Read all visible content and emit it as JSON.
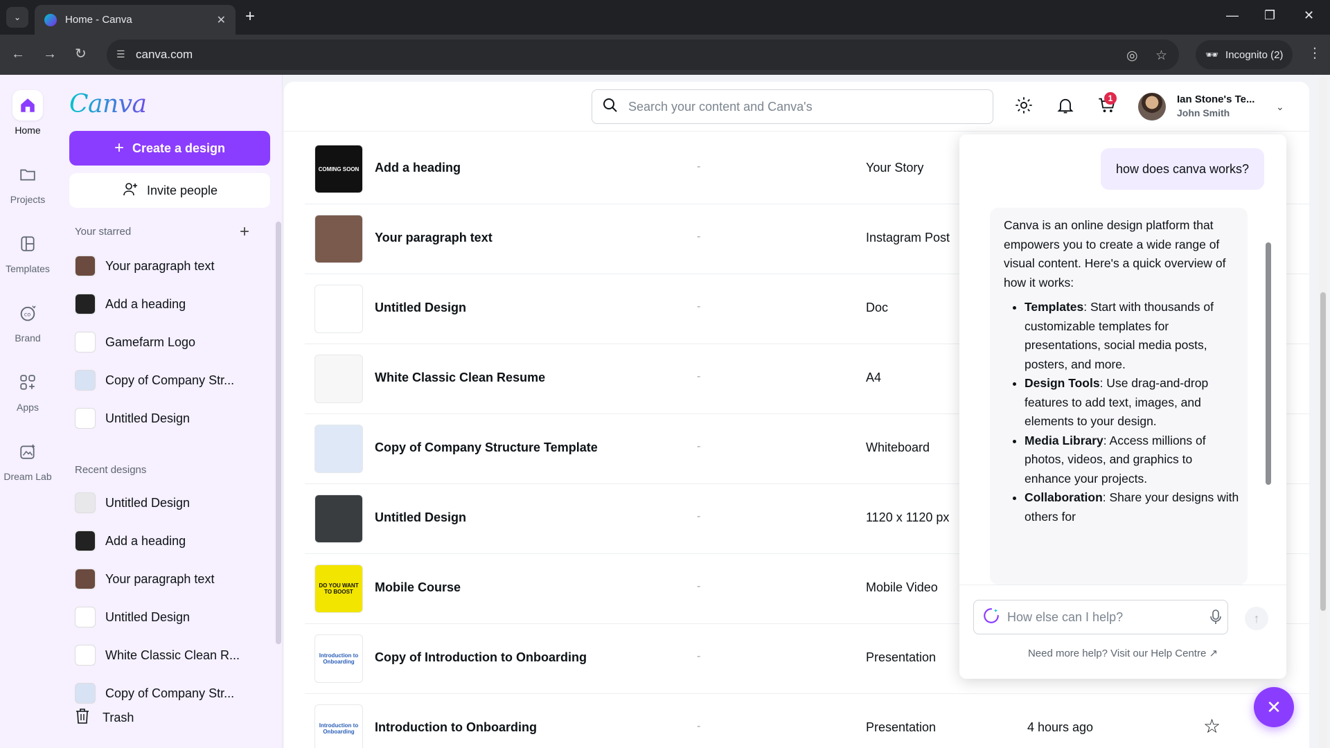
{
  "browser": {
    "tab_title": "Home - Canva",
    "url": "canva.com",
    "incognito": "Incognito (2)"
  },
  "rail": [
    {
      "label": "Home",
      "icon": "home-icon"
    },
    {
      "label": "Projects",
      "icon": "folder-icon"
    },
    {
      "label": "Templates",
      "icon": "templates-icon"
    },
    {
      "label": "Brand",
      "icon": "brand-icon"
    },
    {
      "label": "Apps",
      "icon": "apps-icon"
    },
    {
      "label": "Dream Lab",
      "icon": "dream-lab-icon"
    }
  ],
  "sidebar": {
    "logo": "Canva",
    "create_label": "Create a design",
    "invite_label": "Invite people",
    "starred_title": "Your starred",
    "starred": [
      {
        "label": "Your paragraph text",
        "color": "#6b4a3f"
      },
      {
        "label": "Add a heading",
        "color": "#222222"
      },
      {
        "label": "Gamefarm Logo",
        "color": "#ffffff"
      },
      {
        "label": "Copy of Company Str...",
        "color": "#d7e2f5"
      },
      {
        "label": "Untitled Design",
        "color": "#ffffff"
      }
    ],
    "recent_title": "Recent designs",
    "recent": [
      {
        "label": "Untitled Design",
        "color": "#e8e8ea"
      },
      {
        "label": "Add a heading",
        "color": "#222222"
      },
      {
        "label": "Your paragraph text",
        "color": "#6b4a3f"
      },
      {
        "label": "Untitled Design",
        "color": "#ffffff"
      },
      {
        "label": "White Classic Clean R...",
        "color": "#ffffff"
      },
      {
        "label": "Copy of Company Str...",
        "color": "#d7e2f5"
      }
    ],
    "trash_label": "Trash"
  },
  "topbar": {
    "search_placeholder": "Search your content and Canva's",
    "cart_count": "1",
    "team": "Ian Stone's Te...",
    "user": "John Smith"
  },
  "designs": [
    {
      "title": "Add a heading",
      "owner": "-",
      "type": "Your Story",
      "edited": "",
      "thumb_bg": "#111111",
      "thumb_text": "COMING SOON",
      "thumb_color": "#ffffff"
    },
    {
      "title": "Your paragraph text",
      "owner": "-",
      "type": "Instagram Post",
      "edited": "",
      "thumb_bg": "#7a5a4c",
      "thumb_text": "",
      "thumb_color": "#ffffff"
    },
    {
      "title": "Untitled Design",
      "owner": "-",
      "type": "Doc",
      "edited": "",
      "thumb_bg": "#ffffff",
      "thumb_text": "",
      "thumb_color": "#000000"
    },
    {
      "title": "White Classic Clean Resume",
      "owner": "-",
      "type": "A4",
      "edited": "",
      "thumb_bg": "#f7f7f7",
      "thumb_text": "",
      "thumb_color": "#000000"
    },
    {
      "title": "Copy of Company Structure Template",
      "owner": "-",
      "type": "Whiteboard",
      "edited": "",
      "thumb_bg": "#dfe8f7",
      "thumb_text": "",
      "thumb_color": "#000000"
    },
    {
      "title": "Untitled Design",
      "owner": "-",
      "type": "1120 x 1120 px",
      "edited": "",
      "thumb_bg": "#3a3d40",
      "thumb_text": "",
      "thumb_color": "#ffffff"
    },
    {
      "title": "Mobile Course",
      "owner": "-",
      "type": "Mobile Video",
      "edited": "",
      "thumb_bg": "#f2e500",
      "thumb_text": "DO YOU WANT TO BOOST",
      "thumb_color": "#111111"
    },
    {
      "title": "Copy of Introduction to Onboarding",
      "owner": "-",
      "type": "Presentation",
      "edited": "",
      "thumb_bg": "#ffffff",
      "thumb_text": "Introduction to Onboarding",
      "thumb_color": "#2b5fb8"
    },
    {
      "title": "Introduction to Onboarding",
      "owner": "-",
      "type": "Presentation",
      "edited": "4 hours ago",
      "thumb_bg": "#ffffff",
      "thumb_text": "Introduction to Onboarding",
      "thumb_color": "#2b5fb8"
    }
  ],
  "assistant": {
    "user_message": "how does canva works?",
    "intro": "Canva is an online design platform that empowers you to create a wide range of visual content. Here's a quick overview of how it works:",
    "points": [
      {
        "term": "Templates",
        "text": ": Start with thousands of customizable templates for presentations, social media posts, posters, and more."
      },
      {
        "term": "Design Tools",
        "text": ": Use drag-and-drop features to add text, images, and elements to your design."
      },
      {
        "term": "Media Library",
        "text": ": Access millions of photos, videos, and graphics to enhance your projects."
      },
      {
        "term": "Collaboration",
        "text": ": Share your designs with others for"
      }
    ],
    "input_placeholder": "How else can I help?",
    "help_text": "Need more help? Visit our Help Centre"
  },
  "colors": {
    "accent": "#8b3dff",
    "badge": "#e0294b"
  }
}
